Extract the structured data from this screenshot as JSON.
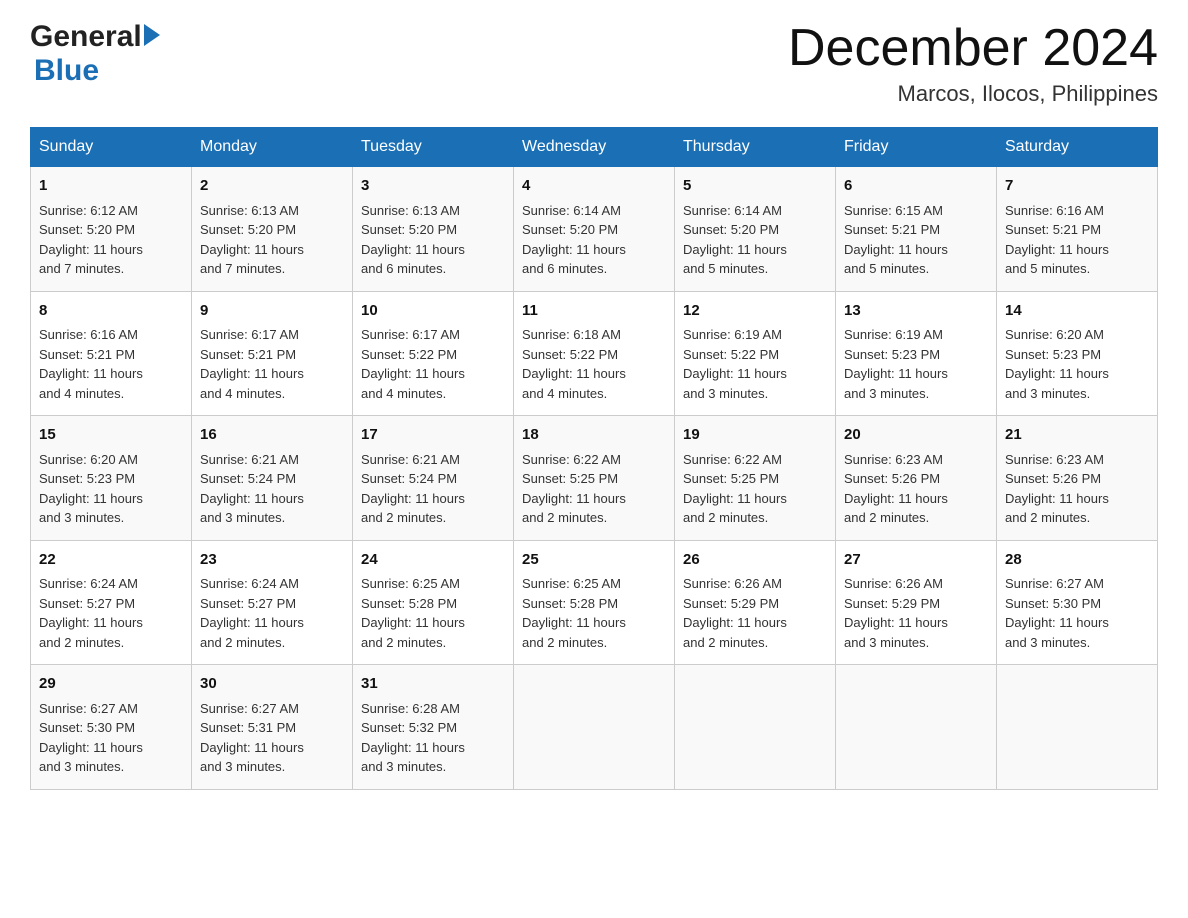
{
  "header": {
    "logo_general": "General",
    "logo_blue": "Blue",
    "month_title": "December 2024",
    "location": "Marcos, Ilocos, Philippines"
  },
  "columns": [
    "Sunday",
    "Monday",
    "Tuesday",
    "Wednesday",
    "Thursday",
    "Friday",
    "Saturday"
  ],
  "weeks": [
    [
      {
        "day": "1",
        "sunrise": "6:12 AM",
        "sunset": "5:20 PM",
        "daylight": "11 hours and 7 minutes."
      },
      {
        "day": "2",
        "sunrise": "6:13 AM",
        "sunset": "5:20 PM",
        "daylight": "11 hours and 7 minutes."
      },
      {
        "day": "3",
        "sunrise": "6:13 AM",
        "sunset": "5:20 PM",
        "daylight": "11 hours and 6 minutes."
      },
      {
        "day": "4",
        "sunrise": "6:14 AM",
        "sunset": "5:20 PM",
        "daylight": "11 hours and 6 minutes."
      },
      {
        "day": "5",
        "sunrise": "6:14 AM",
        "sunset": "5:20 PM",
        "daylight": "11 hours and 5 minutes."
      },
      {
        "day": "6",
        "sunrise": "6:15 AM",
        "sunset": "5:21 PM",
        "daylight": "11 hours and 5 minutes."
      },
      {
        "day": "7",
        "sunrise": "6:16 AM",
        "sunset": "5:21 PM",
        "daylight": "11 hours and 5 minutes."
      }
    ],
    [
      {
        "day": "8",
        "sunrise": "6:16 AM",
        "sunset": "5:21 PM",
        "daylight": "11 hours and 4 minutes."
      },
      {
        "day": "9",
        "sunrise": "6:17 AM",
        "sunset": "5:21 PM",
        "daylight": "11 hours and 4 minutes."
      },
      {
        "day": "10",
        "sunrise": "6:17 AM",
        "sunset": "5:22 PM",
        "daylight": "11 hours and 4 minutes."
      },
      {
        "day": "11",
        "sunrise": "6:18 AM",
        "sunset": "5:22 PM",
        "daylight": "11 hours and 4 minutes."
      },
      {
        "day": "12",
        "sunrise": "6:19 AM",
        "sunset": "5:22 PM",
        "daylight": "11 hours and 3 minutes."
      },
      {
        "day": "13",
        "sunrise": "6:19 AM",
        "sunset": "5:23 PM",
        "daylight": "11 hours and 3 minutes."
      },
      {
        "day": "14",
        "sunrise": "6:20 AM",
        "sunset": "5:23 PM",
        "daylight": "11 hours and 3 minutes."
      }
    ],
    [
      {
        "day": "15",
        "sunrise": "6:20 AM",
        "sunset": "5:23 PM",
        "daylight": "11 hours and 3 minutes."
      },
      {
        "day": "16",
        "sunrise": "6:21 AM",
        "sunset": "5:24 PM",
        "daylight": "11 hours and 3 minutes."
      },
      {
        "day": "17",
        "sunrise": "6:21 AM",
        "sunset": "5:24 PM",
        "daylight": "11 hours and 2 minutes."
      },
      {
        "day": "18",
        "sunrise": "6:22 AM",
        "sunset": "5:25 PM",
        "daylight": "11 hours and 2 minutes."
      },
      {
        "day": "19",
        "sunrise": "6:22 AM",
        "sunset": "5:25 PM",
        "daylight": "11 hours and 2 minutes."
      },
      {
        "day": "20",
        "sunrise": "6:23 AM",
        "sunset": "5:26 PM",
        "daylight": "11 hours and 2 minutes."
      },
      {
        "day": "21",
        "sunrise": "6:23 AM",
        "sunset": "5:26 PM",
        "daylight": "11 hours and 2 minutes."
      }
    ],
    [
      {
        "day": "22",
        "sunrise": "6:24 AM",
        "sunset": "5:27 PM",
        "daylight": "11 hours and 2 minutes."
      },
      {
        "day": "23",
        "sunrise": "6:24 AM",
        "sunset": "5:27 PM",
        "daylight": "11 hours and 2 minutes."
      },
      {
        "day": "24",
        "sunrise": "6:25 AM",
        "sunset": "5:28 PM",
        "daylight": "11 hours and 2 minutes."
      },
      {
        "day": "25",
        "sunrise": "6:25 AM",
        "sunset": "5:28 PM",
        "daylight": "11 hours and 2 minutes."
      },
      {
        "day": "26",
        "sunrise": "6:26 AM",
        "sunset": "5:29 PM",
        "daylight": "11 hours and 2 minutes."
      },
      {
        "day": "27",
        "sunrise": "6:26 AM",
        "sunset": "5:29 PM",
        "daylight": "11 hours and 3 minutes."
      },
      {
        "day": "28",
        "sunrise": "6:27 AM",
        "sunset": "5:30 PM",
        "daylight": "11 hours and 3 minutes."
      }
    ],
    [
      {
        "day": "29",
        "sunrise": "6:27 AM",
        "sunset": "5:30 PM",
        "daylight": "11 hours and 3 minutes."
      },
      {
        "day": "30",
        "sunrise": "6:27 AM",
        "sunset": "5:31 PM",
        "daylight": "11 hours and 3 minutes."
      },
      {
        "day": "31",
        "sunrise": "6:28 AM",
        "sunset": "5:32 PM",
        "daylight": "11 hours and 3 minutes."
      },
      null,
      null,
      null,
      null
    ]
  ],
  "labels": {
    "sunrise": "Sunrise:",
    "sunset": "Sunset:",
    "daylight": "Daylight:"
  }
}
